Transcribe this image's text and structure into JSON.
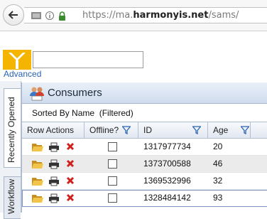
{
  "browser": {
    "url_prefix": "https://ma.",
    "url_domain": "harmonyis.net",
    "url_suffix": "/sams/"
  },
  "header": {
    "search_value": "",
    "advanced_label": "Advanced"
  },
  "side_tabs": {
    "recent": "Recently Opened",
    "workflow": "Workflow"
  },
  "panel": {
    "title": "Consumers",
    "sorted_label": "Sorted By Name",
    "filter_status": "(Filtered)"
  },
  "grid": {
    "columns": [
      "Row Actions",
      "Offline?",
      "ID",
      "Age"
    ],
    "rows": [
      {
        "id": "1317977734",
        "age": "20",
        "offline": false
      },
      {
        "id": "1373700588",
        "age": "46",
        "offline": false
      },
      {
        "id": "1369532996",
        "age": "32",
        "offline": false
      },
      {
        "id": "1328484142",
        "age": "93",
        "offline": false
      }
    ]
  },
  "colors": {
    "accent": "#2a64b4",
    "delete": "#d0201b",
    "folder": "#e8b53a"
  }
}
